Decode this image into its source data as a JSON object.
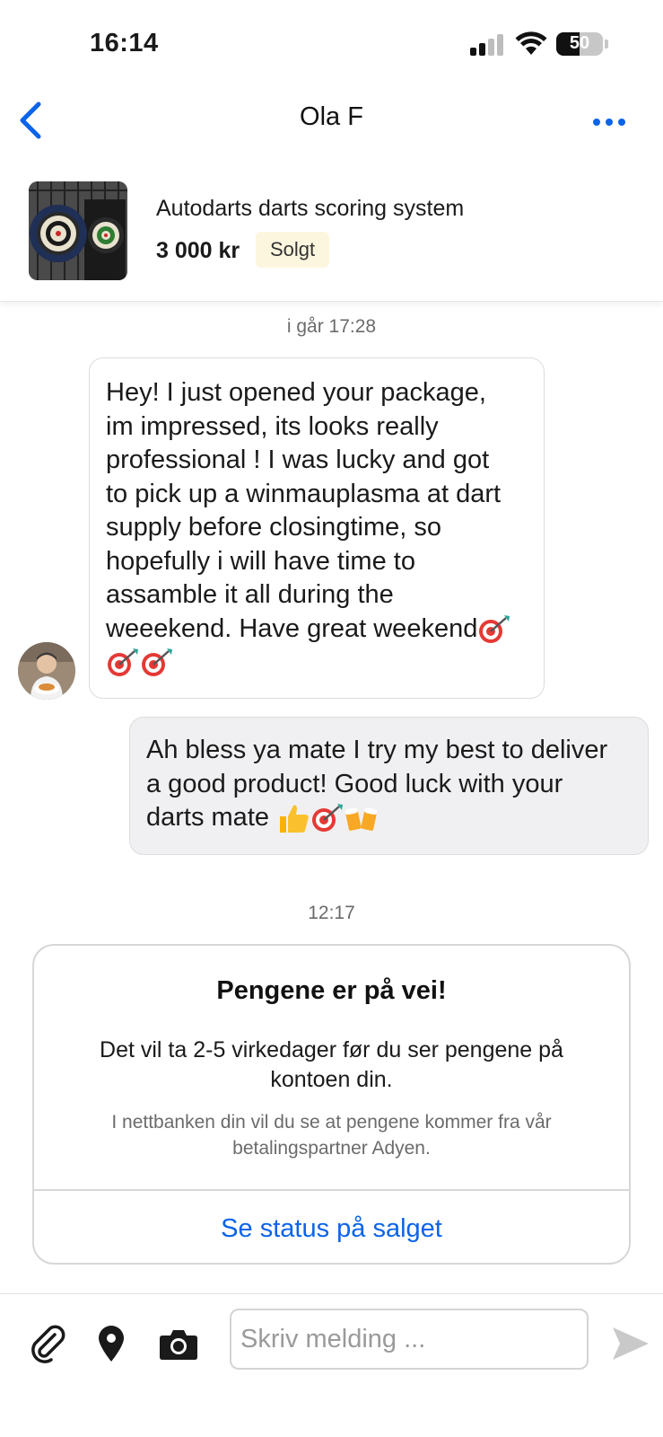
{
  "status_bar": {
    "time": "16:14",
    "battery": "50"
  },
  "header": {
    "title": "Ola F",
    "back_icon": "chevron-left-icon",
    "more_icon": "more-dots-icon",
    "accent_color": "#0a64e8"
  },
  "listing": {
    "title": "Autodarts darts scoring system",
    "price": "3 000 kr",
    "status_badge": "Solgt",
    "badge_color": "#fdf6de"
  },
  "conversation": {
    "timestamp_1": "i går 17:28",
    "incoming_message": {
      "lines": [
        "Hey! I just opened your package,",
        "im impressed, its looks really",
        "professional ! I was lucky and got",
        "to pick up a winmauplasma at dart",
        "supply before closingtime, so",
        "hopefully i will have time to",
        "assamble it all during the",
        "weeekend. Have great weekend"
      ],
      "emojis": [
        "dart-target-icon",
        "dart-target-icon",
        "dart-target-icon"
      ]
    },
    "outgoing_message": {
      "lines": [
        "Ah bless ya mate I try my best to deliver",
        "a good product! Good luck with your",
        "darts mate"
      ],
      "emojis": [
        "thumbs-up-icon",
        "dart-target-icon",
        "beer-mugs-icon"
      ]
    },
    "timestamp_2": "12:17"
  },
  "system_card": {
    "title": "Pengene er på vei!",
    "body_lines": [
      "Det vil ta 2-5 virkedager før du ser pengene på",
      "kontoen din."
    ],
    "note_lines": [
      "I nettbanken din vil du se at pengene kommer fra vår",
      "betalingspartner Adyen."
    ],
    "link_label": "Se status på salget"
  },
  "composer": {
    "placeholder": "Skriv melding ...",
    "icons": [
      "paperclip-icon",
      "location-pin-icon",
      "camera-icon",
      "send-icon"
    ]
  }
}
